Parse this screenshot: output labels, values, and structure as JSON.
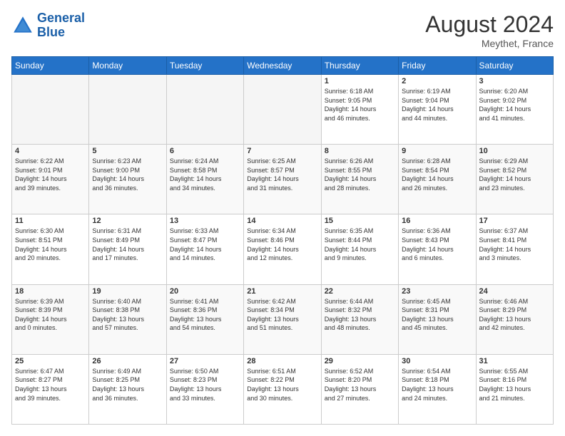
{
  "header": {
    "logo_line1": "General",
    "logo_line2": "Blue",
    "month": "August 2024",
    "location": "Meythet, France"
  },
  "weekdays": [
    "Sunday",
    "Monday",
    "Tuesday",
    "Wednesday",
    "Thursday",
    "Friday",
    "Saturday"
  ],
  "weeks": [
    [
      {
        "day": "",
        "info": ""
      },
      {
        "day": "",
        "info": ""
      },
      {
        "day": "",
        "info": ""
      },
      {
        "day": "",
        "info": ""
      },
      {
        "day": "1",
        "info": "Sunrise: 6:18 AM\nSunset: 9:05 PM\nDaylight: 14 hours\nand 46 minutes."
      },
      {
        "day": "2",
        "info": "Sunrise: 6:19 AM\nSunset: 9:04 PM\nDaylight: 14 hours\nand 44 minutes."
      },
      {
        "day": "3",
        "info": "Sunrise: 6:20 AM\nSunset: 9:02 PM\nDaylight: 14 hours\nand 41 minutes."
      }
    ],
    [
      {
        "day": "4",
        "info": "Sunrise: 6:22 AM\nSunset: 9:01 PM\nDaylight: 14 hours\nand 39 minutes."
      },
      {
        "day": "5",
        "info": "Sunrise: 6:23 AM\nSunset: 9:00 PM\nDaylight: 14 hours\nand 36 minutes."
      },
      {
        "day": "6",
        "info": "Sunrise: 6:24 AM\nSunset: 8:58 PM\nDaylight: 14 hours\nand 34 minutes."
      },
      {
        "day": "7",
        "info": "Sunrise: 6:25 AM\nSunset: 8:57 PM\nDaylight: 14 hours\nand 31 minutes."
      },
      {
        "day": "8",
        "info": "Sunrise: 6:26 AM\nSunset: 8:55 PM\nDaylight: 14 hours\nand 28 minutes."
      },
      {
        "day": "9",
        "info": "Sunrise: 6:28 AM\nSunset: 8:54 PM\nDaylight: 14 hours\nand 26 minutes."
      },
      {
        "day": "10",
        "info": "Sunrise: 6:29 AM\nSunset: 8:52 PM\nDaylight: 14 hours\nand 23 minutes."
      }
    ],
    [
      {
        "day": "11",
        "info": "Sunrise: 6:30 AM\nSunset: 8:51 PM\nDaylight: 14 hours\nand 20 minutes."
      },
      {
        "day": "12",
        "info": "Sunrise: 6:31 AM\nSunset: 8:49 PM\nDaylight: 14 hours\nand 17 minutes."
      },
      {
        "day": "13",
        "info": "Sunrise: 6:33 AM\nSunset: 8:47 PM\nDaylight: 14 hours\nand 14 minutes."
      },
      {
        "day": "14",
        "info": "Sunrise: 6:34 AM\nSunset: 8:46 PM\nDaylight: 14 hours\nand 12 minutes."
      },
      {
        "day": "15",
        "info": "Sunrise: 6:35 AM\nSunset: 8:44 PM\nDaylight: 14 hours\nand 9 minutes."
      },
      {
        "day": "16",
        "info": "Sunrise: 6:36 AM\nSunset: 8:43 PM\nDaylight: 14 hours\nand 6 minutes."
      },
      {
        "day": "17",
        "info": "Sunrise: 6:37 AM\nSunset: 8:41 PM\nDaylight: 14 hours\nand 3 minutes."
      }
    ],
    [
      {
        "day": "18",
        "info": "Sunrise: 6:39 AM\nSunset: 8:39 PM\nDaylight: 14 hours\nand 0 minutes."
      },
      {
        "day": "19",
        "info": "Sunrise: 6:40 AM\nSunset: 8:38 PM\nDaylight: 13 hours\nand 57 minutes."
      },
      {
        "day": "20",
        "info": "Sunrise: 6:41 AM\nSunset: 8:36 PM\nDaylight: 13 hours\nand 54 minutes."
      },
      {
        "day": "21",
        "info": "Sunrise: 6:42 AM\nSunset: 8:34 PM\nDaylight: 13 hours\nand 51 minutes."
      },
      {
        "day": "22",
        "info": "Sunrise: 6:44 AM\nSunset: 8:32 PM\nDaylight: 13 hours\nand 48 minutes."
      },
      {
        "day": "23",
        "info": "Sunrise: 6:45 AM\nSunset: 8:31 PM\nDaylight: 13 hours\nand 45 minutes."
      },
      {
        "day": "24",
        "info": "Sunrise: 6:46 AM\nSunset: 8:29 PM\nDaylight: 13 hours\nand 42 minutes."
      }
    ],
    [
      {
        "day": "25",
        "info": "Sunrise: 6:47 AM\nSunset: 8:27 PM\nDaylight: 13 hours\nand 39 minutes."
      },
      {
        "day": "26",
        "info": "Sunrise: 6:49 AM\nSunset: 8:25 PM\nDaylight: 13 hours\nand 36 minutes."
      },
      {
        "day": "27",
        "info": "Sunrise: 6:50 AM\nSunset: 8:23 PM\nDaylight: 13 hours\nand 33 minutes."
      },
      {
        "day": "28",
        "info": "Sunrise: 6:51 AM\nSunset: 8:22 PM\nDaylight: 13 hours\nand 30 minutes."
      },
      {
        "day": "29",
        "info": "Sunrise: 6:52 AM\nSunset: 8:20 PM\nDaylight: 13 hours\nand 27 minutes."
      },
      {
        "day": "30",
        "info": "Sunrise: 6:54 AM\nSunset: 8:18 PM\nDaylight: 13 hours\nand 24 minutes."
      },
      {
        "day": "31",
        "info": "Sunrise: 6:55 AM\nSunset: 8:16 PM\nDaylight: 13 hours\nand 21 minutes."
      }
    ]
  ]
}
